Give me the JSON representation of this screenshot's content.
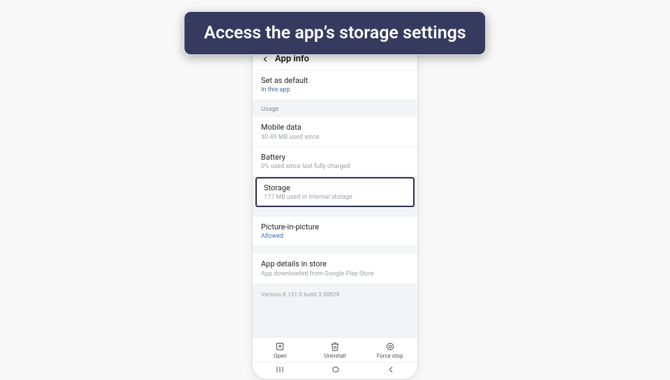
{
  "callout": {
    "text": "Access the app’s storage settings"
  },
  "header": {
    "title": "App info"
  },
  "set_default": {
    "title": "Set as default",
    "sub": "In this app"
  },
  "usage_label": "Usage",
  "mobile_data": {
    "title": "Mobile data",
    "sub": "30.49 MB used since"
  },
  "battery": {
    "title": "Battery",
    "sub": "0% used since last fully charged"
  },
  "storage": {
    "title": "Storage",
    "sub": "177 MB used in Internal storage"
  },
  "pip": {
    "title": "Picture-in-picture",
    "sub": "Allowed"
  },
  "store": {
    "title": "App details in store",
    "sub": "App downloaded from Google Play Store"
  },
  "version": "Version 8.131.0 build 3 50829",
  "actions": {
    "open": "Open",
    "uninstall": "Uninstall",
    "forcestop": "Force stop"
  }
}
